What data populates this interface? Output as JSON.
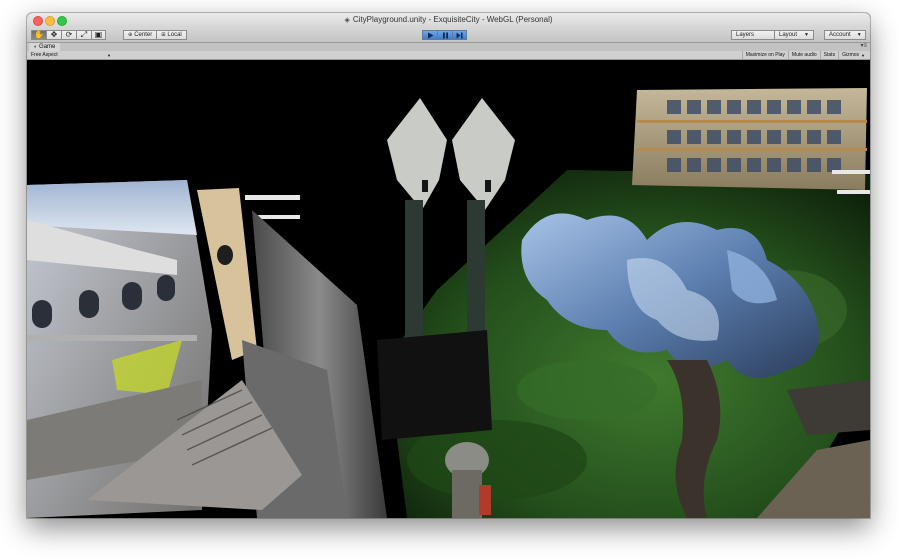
{
  "window": {
    "title": "CityPlayground.unity - ExquisiteCity - WebGL (Personal)"
  },
  "toolbar": {
    "tools": [
      {
        "name": "hand-tool-icon",
        "glyph": "✋"
      },
      {
        "name": "move-tool-icon",
        "glyph": "✥"
      },
      {
        "name": "rotate-tool-icon",
        "glyph": "⟳"
      },
      {
        "name": "scale-tool-icon",
        "glyph": "⤢"
      },
      {
        "name": "rect-tool-icon",
        "glyph": "▣"
      }
    ],
    "center_label": "Center",
    "local_label": "Local",
    "layers_label": "Layers",
    "layout_label": "Layout",
    "account_label": "Account",
    "play_state": "playing",
    "accent_color": "#3f7ecb"
  },
  "game_view": {
    "tab_label": "Game",
    "aspect_label": "Free Aspect",
    "buttons": [
      "Maximize on Play",
      "Mute audio",
      "Stats",
      "Gizmos"
    ]
  }
}
